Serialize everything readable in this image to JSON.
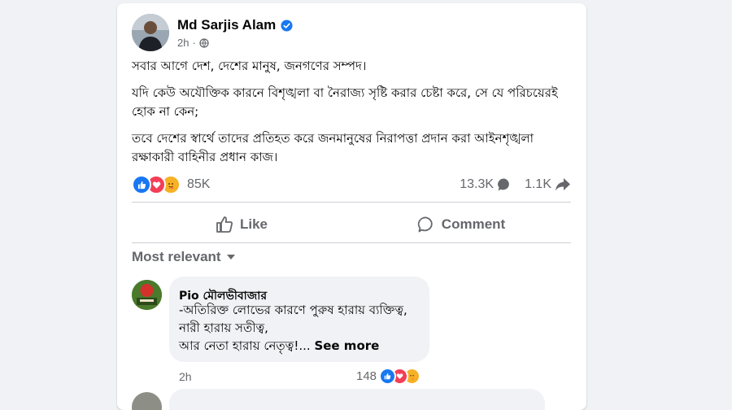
{
  "post": {
    "author": "Md Sarjis Alam",
    "time": "2h",
    "paragraphs": [
      "সবার আগে দেশ, দেশের মানুষ, জনগণের সম্পদ।",
      "যদি কেউ অযৌক্তিক কারনে বিশৃঙ্খলা বা নৈরাজ্য সৃষ্টি করার চেষ্টা করে, সে যে পরিচয়েরই হোক না কেন;",
      "তবে দেশের স্বার্থে তাদের প্রতিহত করে জনমানুষের নিরাপত্তা প্রদান করা আইনশৃঙ্খলা রক্ষাকারী বাহিনীর প্রধান কাজ।"
    ],
    "reaction_count": "85K",
    "comment_count": "13.3K",
    "share_count": "1.1K"
  },
  "actions": {
    "like_label": "Like",
    "comment_label": "Comment"
  },
  "sort": {
    "label": "Most relevant"
  },
  "comment": {
    "name": "Pio মৌলভীবাজার",
    "lines": [
      "-অতিরিক্ত লোভের কারণে পুরুষ হারায় ব্যক্তিত্ব,",
      "নারী হারায় সতীত্ব,",
      "আর নেতা হারায় নেতৃত্ব!..."
    ],
    "see_more": "See more",
    "time": "2h",
    "reaction_count": "148"
  },
  "colors": {
    "like_blue": "#1877f2",
    "love_red": "#f33e58",
    "care_yellow": "#f7b125",
    "secondary_text": "#65676b"
  },
  "icons": {
    "privacy": "globe-icon",
    "verified": "verified-badge-icon",
    "comment_stat": "comment-bubble-icon",
    "share_stat": "share-arrow-icon",
    "like_action": "thumbs-up-icon",
    "comment_action": "comment-icon",
    "sort": "caret-down-icon"
  }
}
